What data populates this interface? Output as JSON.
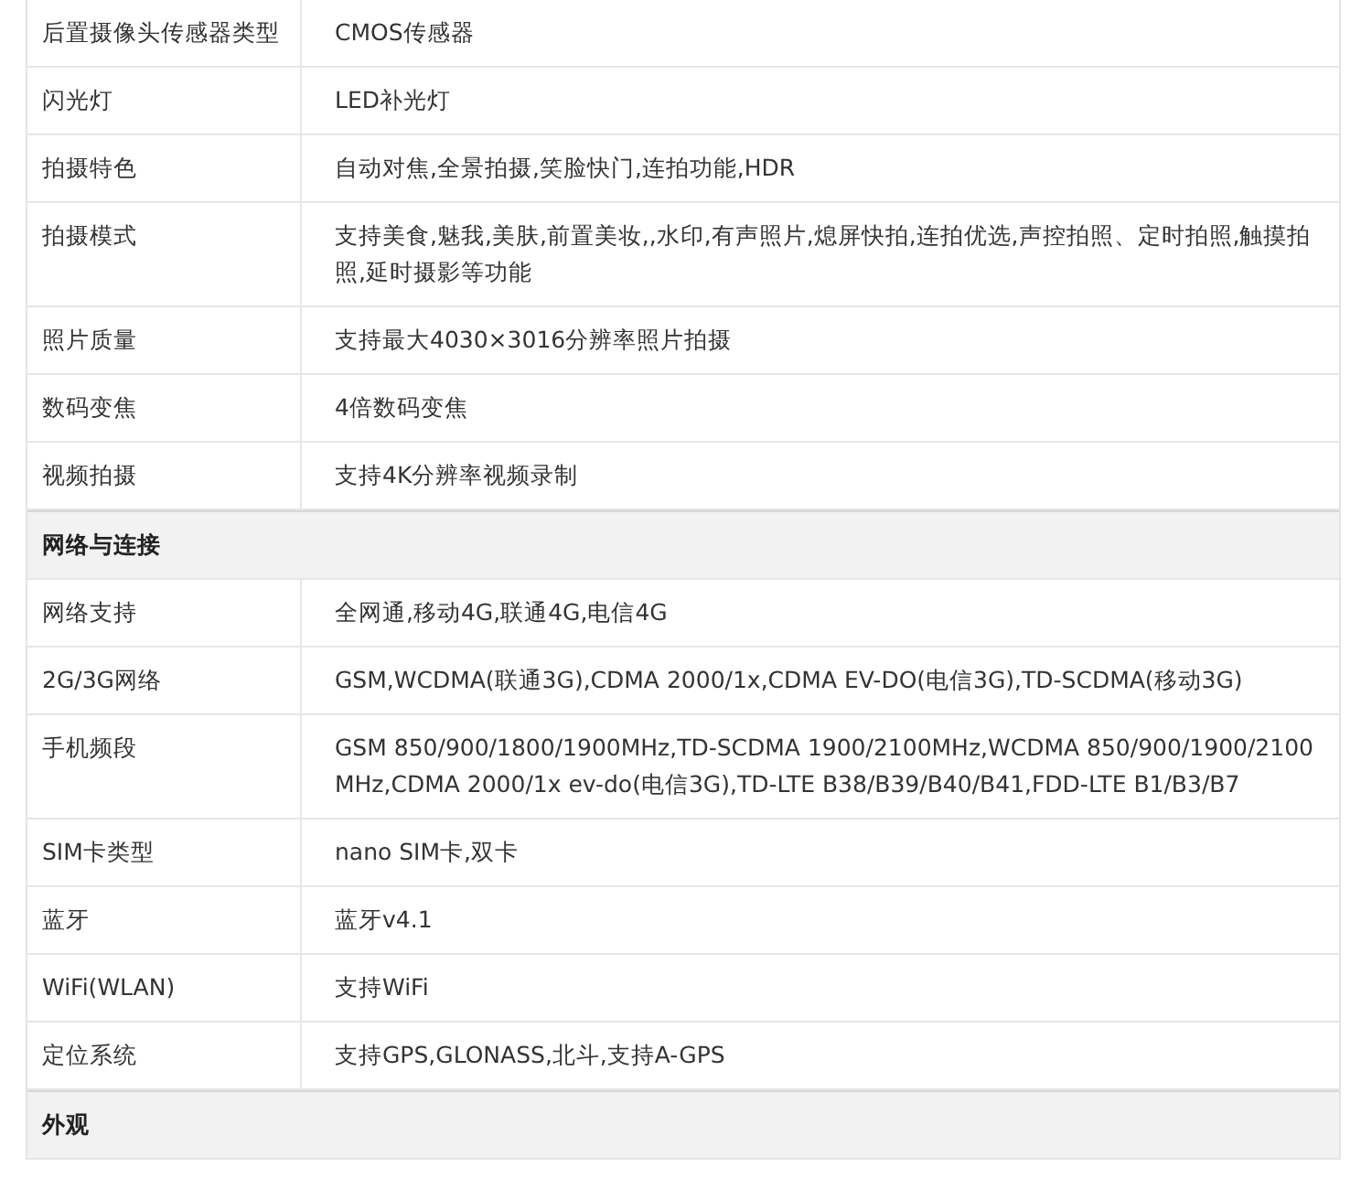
{
  "spec_table": {
    "rows": [
      {
        "kind": "row",
        "label": "后置摄像头传感器类型",
        "value": "CMOS传感器"
      },
      {
        "kind": "row",
        "label": "闪光灯",
        "value": "LED补光灯"
      },
      {
        "kind": "row",
        "label": "拍摄特色",
        "value": "自动对焦,全景拍摄,笑脸快门,连拍功能,HDR"
      },
      {
        "kind": "row",
        "label": "拍摄模式",
        "value": "支持美食,魅我,美肤,前置美妆,,水印,有声照片,熄屏快拍,连拍优选,声控拍照、定时拍照,触摸拍照,延时摄影等功能"
      },
      {
        "kind": "row",
        "label": "照片质量",
        "value": "支持最大4030×3016分辨率照片拍摄"
      },
      {
        "kind": "row",
        "label": "数码变焦",
        "value": "4倍数码变焦"
      },
      {
        "kind": "row",
        "label": "视频拍摄",
        "value": "支持4K分辨率视频录制"
      },
      {
        "kind": "section",
        "label": "网络与连接"
      },
      {
        "kind": "row",
        "label": "网络支持",
        "value": "全网通,移动4G,联通4G,电信4G"
      },
      {
        "kind": "row",
        "label": "2G/3G网络",
        "value": "GSM,WCDMA(联通3G),CDMA 2000/1x,CDMA EV-DO(电信3G),TD-SCDMA(移动3G)"
      },
      {
        "kind": "row",
        "label": "手机频段",
        "value": "GSM 850/900/1800/1900MHz,TD-SCDMA 1900/2100MHz,WCDMA 850/900/1900/2100MHz,CDMA 2000/1x ev-do(电信3G),TD-LTE B38/B39/B40/B41,FDD-LTE B1/B3/B7"
      },
      {
        "kind": "row",
        "label": "SIM卡类型",
        "value": "nano SIM卡,双卡"
      },
      {
        "kind": "row",
        "label": "蓝牙",
        "value": "蓝牙v4.1"
      },
      {
        "kind": "row",
        "label": "WiFi(WLAN)",
        "value": "支持WiFi"
      },
      {
        "kind": "row",
        "label": "定位系统",
        "value": "支持GPS,GLONASS,北斗,支持A-GPS"
      },
      {
        "kind": "section",
        "label": "外观"
      }
    ]
  }
}
